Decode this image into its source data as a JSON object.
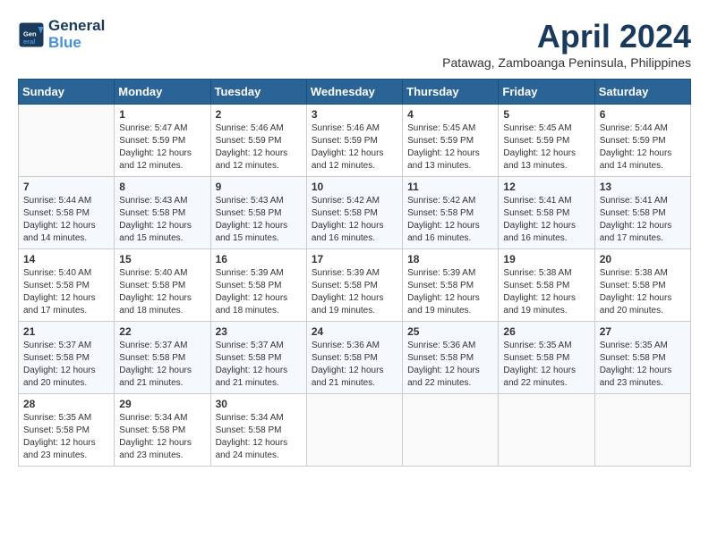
{
  "header": {
    "logo_general": "General",
    "logo_blue": "Blue",
    "month_year": "April 2024",
    "location": "Patawag, Zamboanga Peninsula, Philippines"
  },
  "days_of_week": [
    "Sunday",
    "Monday",
    "Tuesday",
    "Wednesday",
    "Thursday",
    "Friday",
    "Saturday"
  ],
  "weeks": [
    [
      {
        "day": "",
        "sunrise": "",
        "sunset": "",
        "daylight": ""
      },
      {
        "day": "1",
        "sunrise": "Sunrise: 5:47 AM",
        "sunset": "Sunset: 5:59 PM",
        "daylight": "Daylight: 12 hours and 12 minutes."
      },
      {
        "day": "2",
        "sunrise": "Sunrise: 5:46 AM",
        "sunset": "Sunset: 5:59 PM",
        "daylight": "Daylight: 12 hours and 12 minutes."
      },
      {
        "day": "3",
        "sunrise": "Sunrise: 5:46 AM",
        "sunset": "Sunset: 5:59 PM",
        "daylight": "Daylight: 12 hours and 12 minutes."
      },
      {
        "day": "4",
        "sunrise": "Sunrise: 5:45 AM",
        "sunset": "Sunset: 5:59 PM",
        "daylight": "Daylight: 12 hours and 13 minutes."
      },
      {
        "day": "5",
        "sunrise": "Sunrise: 5:45 AM",
        "sunset": "Sunset: 5:59 PM",
        "daylight": "Daylight: 12 hours and 13 minutes."
      },
      {
        "day": "6",
        "sunrise": "Sunrise: 5:44 AM",
        "sunset": "Sunset: 5:59 PM",
        "daylight": "Daylight: 12 hours and 14 minutes."
      }
    ],
    [
      {
        "day": "7",
        "sunrise": "Sunrise: 5:44 AM",
        "sunset": "Sunset: 5:58 PM",
        "daylight": "Daylight: 12 hours and 14 minutes."
      },
      {
        "day": "8",
        "sunrise": "Sunrise: 5:43 AM",
        "sunset": "Sunset: 5:58 PM",
        "daylight": "Daylight: 12 hours and 15 minutes."
      },
      {
        "day": "9",
        "sunrise": "Sunrise: 5:43 AM",
        "sunset": "Sunset: 5:58 PM",
        "daylight": "Daylight: 12 hours and 15 minutes."
      },
      {
        "day": "10",
        "sunrise": "Sunrise: 5:42 AM",
        "sunset": "Sunset: 5:58 PM",
        "daylight": "Daylight: 12 hours and 16 minutes."
      },
      {
        "day": "11",
        "sunrise": "Sunrise: 5:42 AM",
        "sunset": "Sunset: 5:58 PM",
        "daylight": "Daylight: 12 hours and 16 minutes."
      },
      {
        "day": "12",
        "sunrise": "Sunrise: 5:41 AM",
        "sunset": "Sunset: 5:58 PM",
        "daylight": "Daylight: 12 hours and 16 minutes."
      },
      {
        "day": "13",
        "sunrise": "Sunrise: 5:41 AM",
        "sunset": "Sunset: 5:58 PM",
        "daylight": "Daylight: 12 hours and 17 minutes."
      }
    ],
    [
      {
        "day": "14",
        "sunrise": "Sunrise: 5:40 AM",
        "sunset": "Sunset: 5:58 PM",
        "daylight": "Daylight: 12 hours and 17 minutes."
      },
      {
        "day": "15",
        "sunrise": "Sunrise: 5:40 AM",
        "sunset": "Sunset: 5:58 PM",
        "daylight": "Daylight: 12 hours and 18 minutes."
      },
      {
        "day": "16",
        "sunrise": "Sunrise: 5:39 AM",
        "sunset": "Sunset: 5:58 PM",
        "daylight": "Daylight: 12 hours and 18 minutes."
      },
      {
        "day": "17",
        "sunrise": "Sunrise: 5:39 AM",
        "sunset": "Sunset: 5:58 PM",
        "daylight": "Daylight: 12 hours and 19 minutes."
      },
      {
        "day": "18",
        "sunrise": "Sunrise: 5:39 AM",
        "sunset": "Sunset: 5:58 PM",
        "daylight": "Daylight: 12 hours and 19 minutes."
      },
      {
        "day": "19",
        "sunrise": "Sunrise: 5:38 AM",
        "sunset": "Sunset: 5:58 PM",
        "daylight": "Daylight: 12 hours and 19 minutes."
      },
      {
        "day": "20",
        "sunrise": "Sunrise: 5:38 AM",
        "sunset": "Sunset: 5:58 PM",
        "daylight": "Daylight: 12 hours and 20 minutes."
      }
    ],
    [
      {
        "day": "21",
        "sunrise": "Sunrise: 5:37 AM",
        "sunset": "Sunset: 5:58 PM",
        "daylight": "Daylight: 12 hours and 20 minutes."
      },
      {
        "day": "22",
        "sunrise": "Sunrise: 5:37 AM",
        "sunset": "Sunset: 5:58 PM",
        "daylight": "Daylight: 12 hours and 21 minutes."
      },
      {
        "day": "23",
        "sunrise": "Sunrise: 5:37 AM",
        "sunset": "Sunset: 5:58 PM",
        "daylight": "Daylight: 12 hours and 21 minutes."
      },
      {
        "day": "24",
        "sunrise": "Sunrise: 5:36 AM",
        "sunset": "Sunset: 5:58 PM",
        "daylight": "Daylight: 12 hours and 21 minutes."
      },
      {
        "day": "25",
        "sunrise": "Sunrise: 5:36 AM",
        "sunset": "Sunset: 5:58 PM",
        "daylight": "Daylight: 12 hours and 22 minutes."
      },
      {
        "day": "26",
        "sunrise": "Sunrise: 5:35 AM",
        "sunset": "Sunset: 5:58 PM",
        "daylight": "Daylight: 12 hours and 22 minutes."
      },
      {
        "day": "27",
        "sunrise": "Sunrise: 5:35 AM",
        "sunset": "Sunset: 5:58 PM",
        "daylight": "Daylight: 12 hours and 23 minutes."
      }
    ],
    [
      {
        "day": "28",
        "sunrise": "Sunrise: 5:35 AM",
        "sunset": "Sunset: 5:58 PM",
        "daylight": "Daylight: 12 hours and 23 minutes."
      },
      {
        "day": "29",
        "sunrise": "Sunrise: 5:34 AM",
        "sunset": "Sunset: 5:58 PM",
        "daylight": "Daylight: 12 hours and 23 minutes."
      },
      {
        "day": "30",
        "sunrise": "Sunrise: 5:34 AM",
        "sunset": "Sunset: 5:58 PM",
        "daylight": "Daylight: 12 hours and 24 minutes."
      },
      {
        "day": "",
        "sunrise": "",
        "sunset": "",
        "daylight": ""
      },
      {
        "day": "",
        "sunrise": "",
        "sunset": "",
        "daylight": ""
      },
      {
        "day": "",
        "sunrise": "",
        "sunset": "",
        "daylight": ""
      },
      {
        "day": "",
        "sunrise": "",
        "sunset": "",
        "daylight": ""
      }
    ]
  ]
}
